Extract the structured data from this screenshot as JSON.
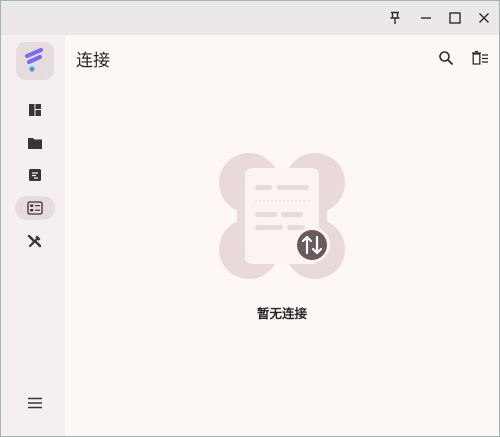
{
  "page": {
    "title": "连接",
    "empty_message": "暂无连接"
  },
  "titlebar": {
    "buttons": [
      "pin-icon",
      "minimize-icon",
      "maximize-icon",
      "close-icon"
    ]
  },
  "sidebar": {
    "items": [
      {
        "name": "dashboard",
        "icon": "layout-icon",
        "active": false
      },
      {
        "name": "files",
        "icon": "folder-icon",
        "active": false
      },
      {
        "name": "scripts",
        "icon": "script-icon",
        "active": false
      },
      {
        "name": "connections",
        "icon": "connections-icon",
        "active": true
      },
      {
        "name": "tools",
        "icon": "tools-icon",
        "active": false
      }
    ],
    "menu_icon": "menu-icon"
  },
  "colors": {
    "accent": "#6b5a5d",
    "logo_primary": "#7a6cf0",
    "logo_secondary": "#3fa3e8",
    "blob": "#ead9da",
    "active_nav": "#e8dadd"
  }
}
